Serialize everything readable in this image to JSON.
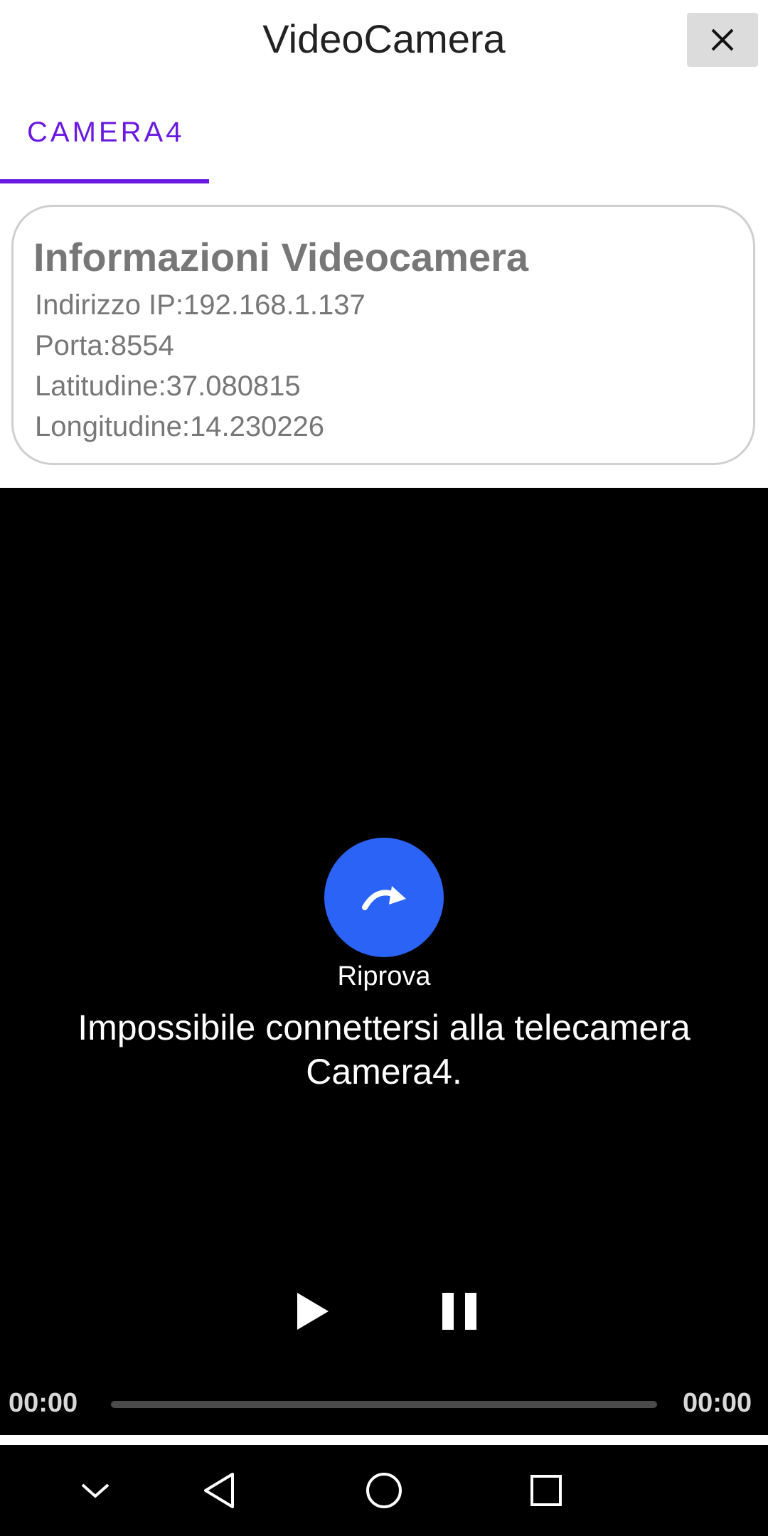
{
  "header": {
    "title": "VideoCamera",
    "close_icon": "close-icon"
  },
  "tabs": [
    {
      "label": "CAMERA4",
      "selected": true
    }
  ],
  "info": {
    "title": "Informazioni Videocamera",
    "ip": "Indirizzo IP:192.168.1.137",
    "port": "Porta:8554",
    "latitude": "Latitudine:37.080815",
    "longitude": "Longitudine:14.230226"
  },
  "video": {
    "retry_icon": "redo-icon",
    "retry_label": "Riprova",
    "error_message": "Impossibile connettersi alla telecamera Camera4.",
    "time_current": "00:00",
    "time_total": "00:00",
    "progress": 0
  },
  "navbar": {
    "icons": [
      "chevron-down-icon",
      "back-icon",
      "home-icon",
      "recents-icon"
    ]
  },
  "colors": {
    "accent": "#6a1ae0",
    "retry_button": "#2b63f7",
    "video_background": "#000000"
  }
}
